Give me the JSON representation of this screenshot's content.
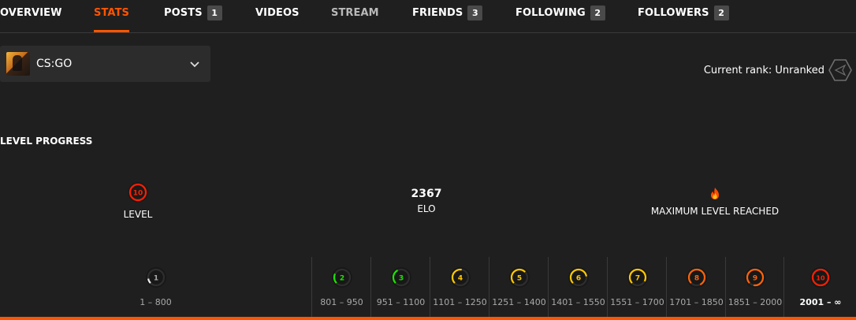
{
  "tabs": [
    {
      "label": "OVERVIEW",
      "state": "normal"
    },
    {
      "label": "STATS",
      "state": "active"
    },
    {
      "label": "POSTS",
      "badge": "1",
      "state": "normal"
    },
    {
      "label": "VIDEOS",
      "state": "normal"
    },
    {
      "label": "STREAM",
      "state": "muted"
    },
    {
      "label": "FRIENDS",
      "badge": "3",
      "state": "normal"
    },
    {
      "label": "FOLLOWING",
      "badge": "2",
      "state": "normal"
    },
    {
      "label": "FOLLOWERS",
      "badge": "2",
      "state": "normal"
    }
  ],
  "game_select": {
    "value": "CS:GO",
    "icon": "chevron-down-icon"
  },
  "rank": {
    "label": "Current rank: Unranked",
    "icon": "unranked-hexagon-icon"
  },
  "section_title": "LEVEL PROGRESS",
  "summary": {
    "level": {
      "value": "10",
      "label": "LEVEL"
    },
    "elo": {
      "value": "2367",
      "label": "ELO"
    },
    "max": {
      "icon": "flame-icon",
      "label": "MAXIMUM LEVEL REACHED"
    }
  },
  "levels": [
    {
      "level": "1",
      "range": "1 – 800",
      "color": "#eeeeee",
      "fill": 0.1
    },
    {
      "level": "2",
      "range": "801 – 950",
      "color": "#1ce400",
      "fill": 0.2
    },
    {
      "level": "3",
      "range": "951 – 1100",
      "color": "#1ce400",
      "fill": 0.3
    },
    {
      "level": "4",
      "range": "1101 – 1250",
      "color": "#ffc800",
      "fill": 0.4
    },
    {
      "level": "5",
      "range": "1251 – 1400",
      "color": "#ffc800",
      "fill": 0.5
    },
    {
      "level": "6",
      "range": "1401 – 1550",
      "color": "#ffc800",
      "fill": 0.6
    },
    {
      "level": "7",
      "range": "1551 – 1700",
      "color": "#ffc800",
      "fill": 0.7
    },
    {
      "level": "8",
      "range": "1701 – 1850",
      "color": "#ff6309",
      "fill": 0.8
    },
    {
      "level": "9",
      "range": "1851 – 2000",
      "color": "#ff6309",
      "fill": 0.9
    },
    {
      "level": "10",
      "range": "2001 – ∞",
      "color": "#fe1f00",
      "fill": 1.0,
      "current": true
    }
  ],
  "colors": {
    "accent": "#ff5500",
    "background": "#1f1f1f",
    "panel": "#2c2c2c"
  }
}
